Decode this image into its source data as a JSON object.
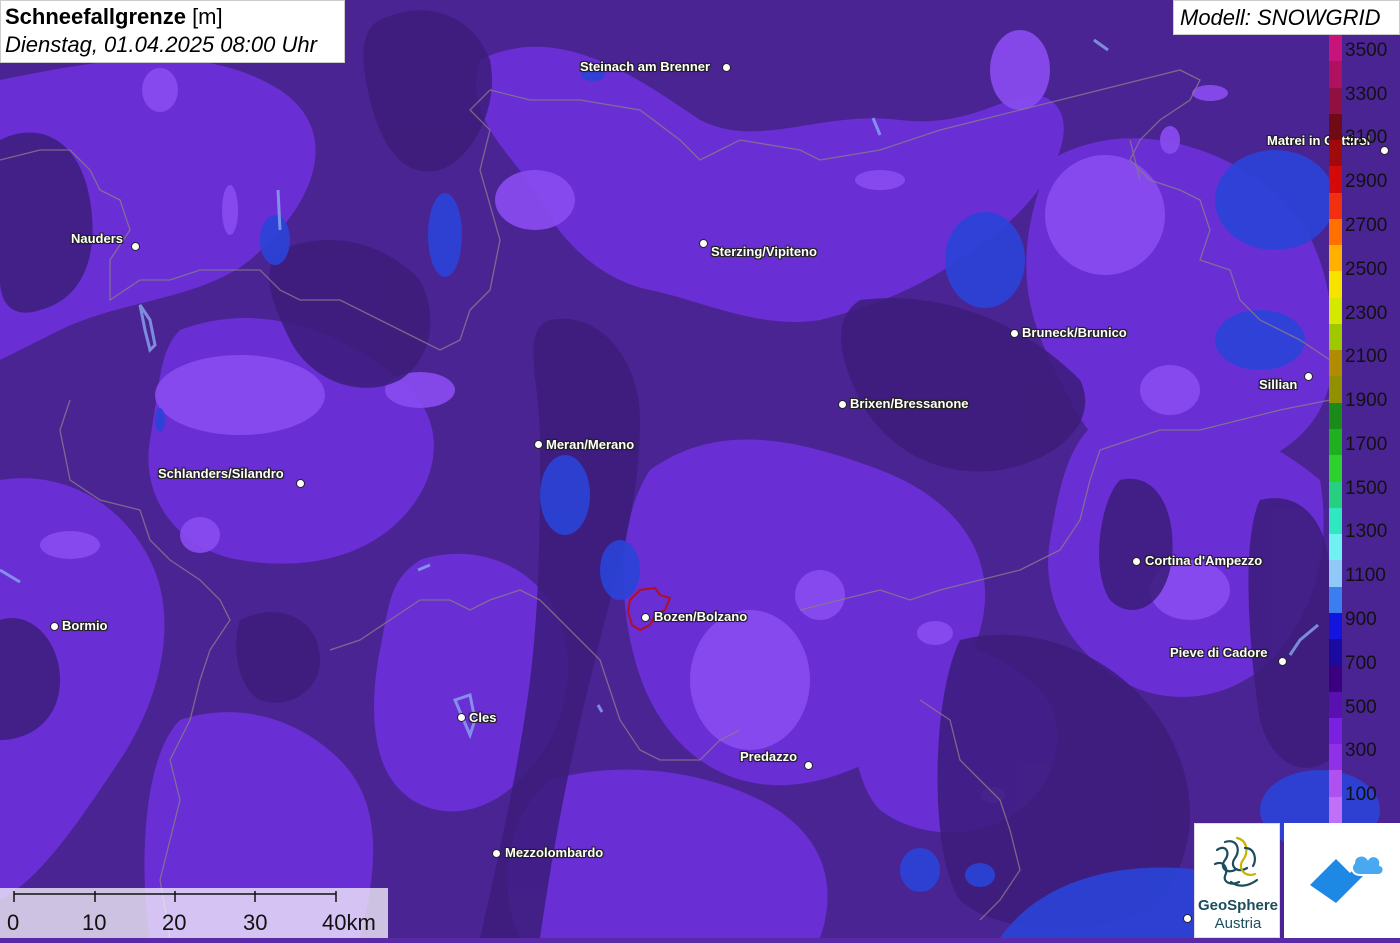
{
  "title": {
    "bold": "Schneefallgrenze",
    "unit": " [m]",
    "subtitle": "Dienstag, 01.04.2025 08:00 Uhr"
  },
  "model": "Modell: SNOWGRID",
  "legend": {
    "labels": [
      "3500",
      "3300",
      "3100",
      "2900",
      "2700",
      "2500",
      "2300",
      "2100",
      "1900",
      "1700",
      "1500",
      "1300",
      "1100",
      "900",
      "700",
      "500",
      "300",
      "100"
    ],
    "colors": [
      "#c8147a",
      "#b01060",
      "#901040",
      "#700a14",
      "#a00a0a",
      "#d40a0a",
      "#f03010",
      "#ff7000",
      "#ffb000",
      "#f6e400",
      "#d4e800",
      "#a0c800",
      "#b08c00",
      "#909000",
      "#1a8a1a",
      "#1fb01f",
      "#2ed02e",
      "#26d080",
      "#30e8c0",
      "#70f0f0",
      "#90c8f8",
      "#3a7ef0",
      "#1414e0",
      "#1a0aa0",
      "#3a0080",
      "#5a10b0",
      "#7a20e0",
      "#9030e8",
      "#b050f0",
      "#c070f8"
    ]
  },
  "cities": [
    {
      "name": "Steinach am Brenner"
    },
    {
      "name": "Nauders"
    },
    {
      "name": "Sterzing/Vipiteno"
    },
    {
      "name": "Matrei in Osttirol"
    },
    {
      "name": "Bruneck/Brunico"
    },
    {
      "name": "Sillian"
    },
    {
      "name": "Brixen/Bressanone"
    },
    {
      "name": "Meran/Merano"
    },
    {
      "name": "Schlanders/Silandro"
    },
    {
      "name": "Cortina d'Ampezzo"
    },
    {
      "name": "Bozen/Bolzano"
    },
    {
      "name": "Bormio"
    },
    {
      "name": "Pieve di Cadore"
    },
    {
      "name": "Cles"
    },
    {
      "name": "Predazzo"
    },
    {
      "name": "Mezzolombardo"
    }
  ],
  "scale": {
    "labels": [
      "0",
      "10",
      "20",
      "30",
      "40km"
    ]
  },
  "logos": {
    "geosphere_name": "GeoSphere",
    "geosphere_sub": "Austria"
  }
}
